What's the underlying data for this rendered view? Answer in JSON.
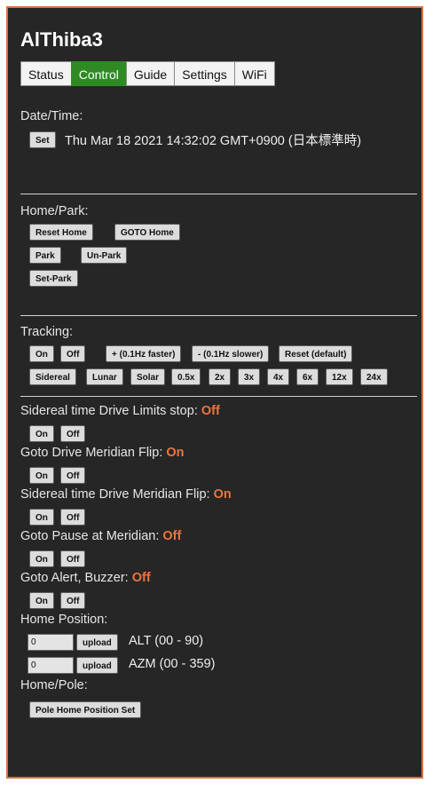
{
  "app_title": "AlThiba3",
  "tabs": [
    {
      "label": "Status"
    },
    {
      "label": "Control"
    },
    {
      "label": "Guide"
    },
    {
      "label": "Settings"
    },
    {
      "label": "WiFi"
    }
  ],
  "active_tab": "Control",
  "datetime": {
    "heading": "Date/Time:",
    "set_label": "Set",
    "value": "Thu Mar 18 2021 14:32:02 GMT+0900 (日本標準時)"
  },
  "home_park": {
    "heading": "Home/Park:",
    "reset_home": "Reset Home",
    "goto_home": "GOTO Home",
    "park": "Park",
    "unpark": "Un-Park",
    "set_park": "Set-Park"
  },
  "tracking": {
    "heading": "Tracking:",
    "on": "On",
    "off": "Off",
    "faster": "+ (0.1Hz faster)",
    "slower": "- (0.1Hz slower)",
    "reset": "Reset (default)",
    "rates": [
      "Sidereal",
      "Lunar",
      "Solar",
      "0.5x",
      "2x",
      "3x",
      "4x",
      "6x",
      "12x",
      "24x"
    ]
  },
  "options": [
    {
      "label": "Sidereal time Drive Limits stop:",
      "value": "Off"
    },
    {
      "label": "Goto Drive Meridian Flip:",
      "value": "On"
    },
    {
      "label": "Sidereal time Drive Meridian Flip:",
      "value": "On"
    },
    {
      "label": "Goto Pause at Meridian:",
      "value": "Off"
    },
    {
      "label": "Goto Alert, Buzzer:",
      "value": "Off"
    }
  ],
  "option_buttons": {
    "on": "On",
    "off": "Off"
  },
  "home_position": {
    "heading": "Home Position:",
    "alt_value": "0",
    "azm_value": "0",
    "upload_label": "upload",
    "alt_range": "ALT (00 - 90)",
    "azm_range": "AZM (00 - 359)"
  },
  "home_pole": {
    "heading": "Home/Pole:",
    "button": "Pole Home Position Set"
  },
  "colors": {
    "accent": "#d9713a",
    "active_tab": "#2e8b24",
    "status_value": "#e9773e",
    "background": "#262626"
  }
}
